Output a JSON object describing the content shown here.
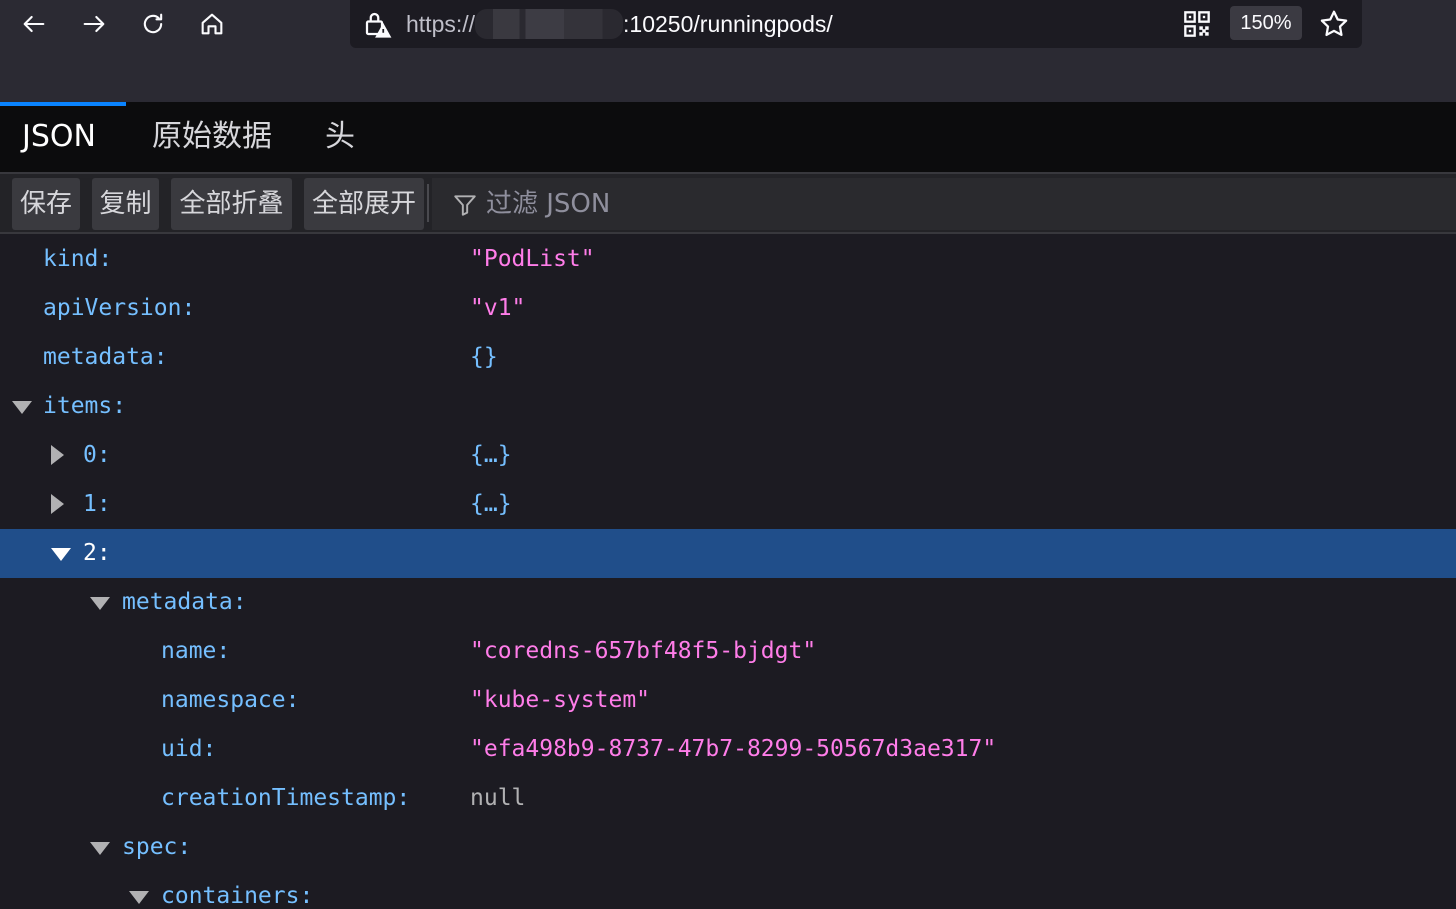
{
  "browser": {
    "url_protocol": "https://",
    "url_rest": ":10250/runningpods/",
    "zoom": "150%"
  },
  "tabs": [
    {
      "label": "JSON",
      "active": true
    },
    {
      "label": "原始数据",
      "active": false
    },
    {
      "label": "头",
      "active": false
    }
  ],
  "toolbar": {
    "save": "保存",
    "copy": "复制",
    "collapse_all": "全部折叠",
    "expand_all": "全部展开",
    "filter_placeholder": "过滤 JSON"
  },
  "tree": [
    {
      "key": "kind:",
      "value": "\"PodList\"",
      "type": "str",
      "depth": 0
    },
    {
      "key": "apiVersion:",
      "value": "\"v1\"",
      "type": "str",
      "depth": 0
    },
    {
      "key": "metadata:",
      "value": "{}",
      "type": "obj",
      "depth": 0
    },
    {
      "key": "items:",
      "value": "",
      "type": "open",
      "depth": 0
    },
    {
      "key": "0:",
      "value": "{…}",
      "type": "closed",
      "depth": 1
    },
    {
      "key": "1:",
      "value": "{…}",
      "type": "closed",
      "depth": 1
    },
    {
      "key": "2:",
      "value": "",
      "type": "open",
      "depth": 1,
      "selected": true
    },
    {
      "key": "metadata:",
      "value": "",
      "type": "open",
      "depth": 2
    },
    {
      "key": "name:",
      "value": "\"coredns-657bf48f5-bjdgt\"",
      "type": "str",
      "depth": 3
    },
    {
      "key": "namespace:",
      "value": "\"kube-system\"",
      "type": "str",
      "depth": 3
    },
    {
      "key": "uid:",
      "value": "\"efa498b9-8737-47b7-8299-50567d3ae317\"",
      "type": "str",
      "depth": 3
    },
    {
      "key": "creationTimestamp:",
      "value": "null",
      "type": "null",
      "depth": 3
    },
    {
      "key": "spec:",
      "value": "",
      "type": "open",
      "depth": 2
    },
    {
      "key": "containers:",
      "value": "",
      "type": "open",
      "depth": 3
    }
  ]
}
